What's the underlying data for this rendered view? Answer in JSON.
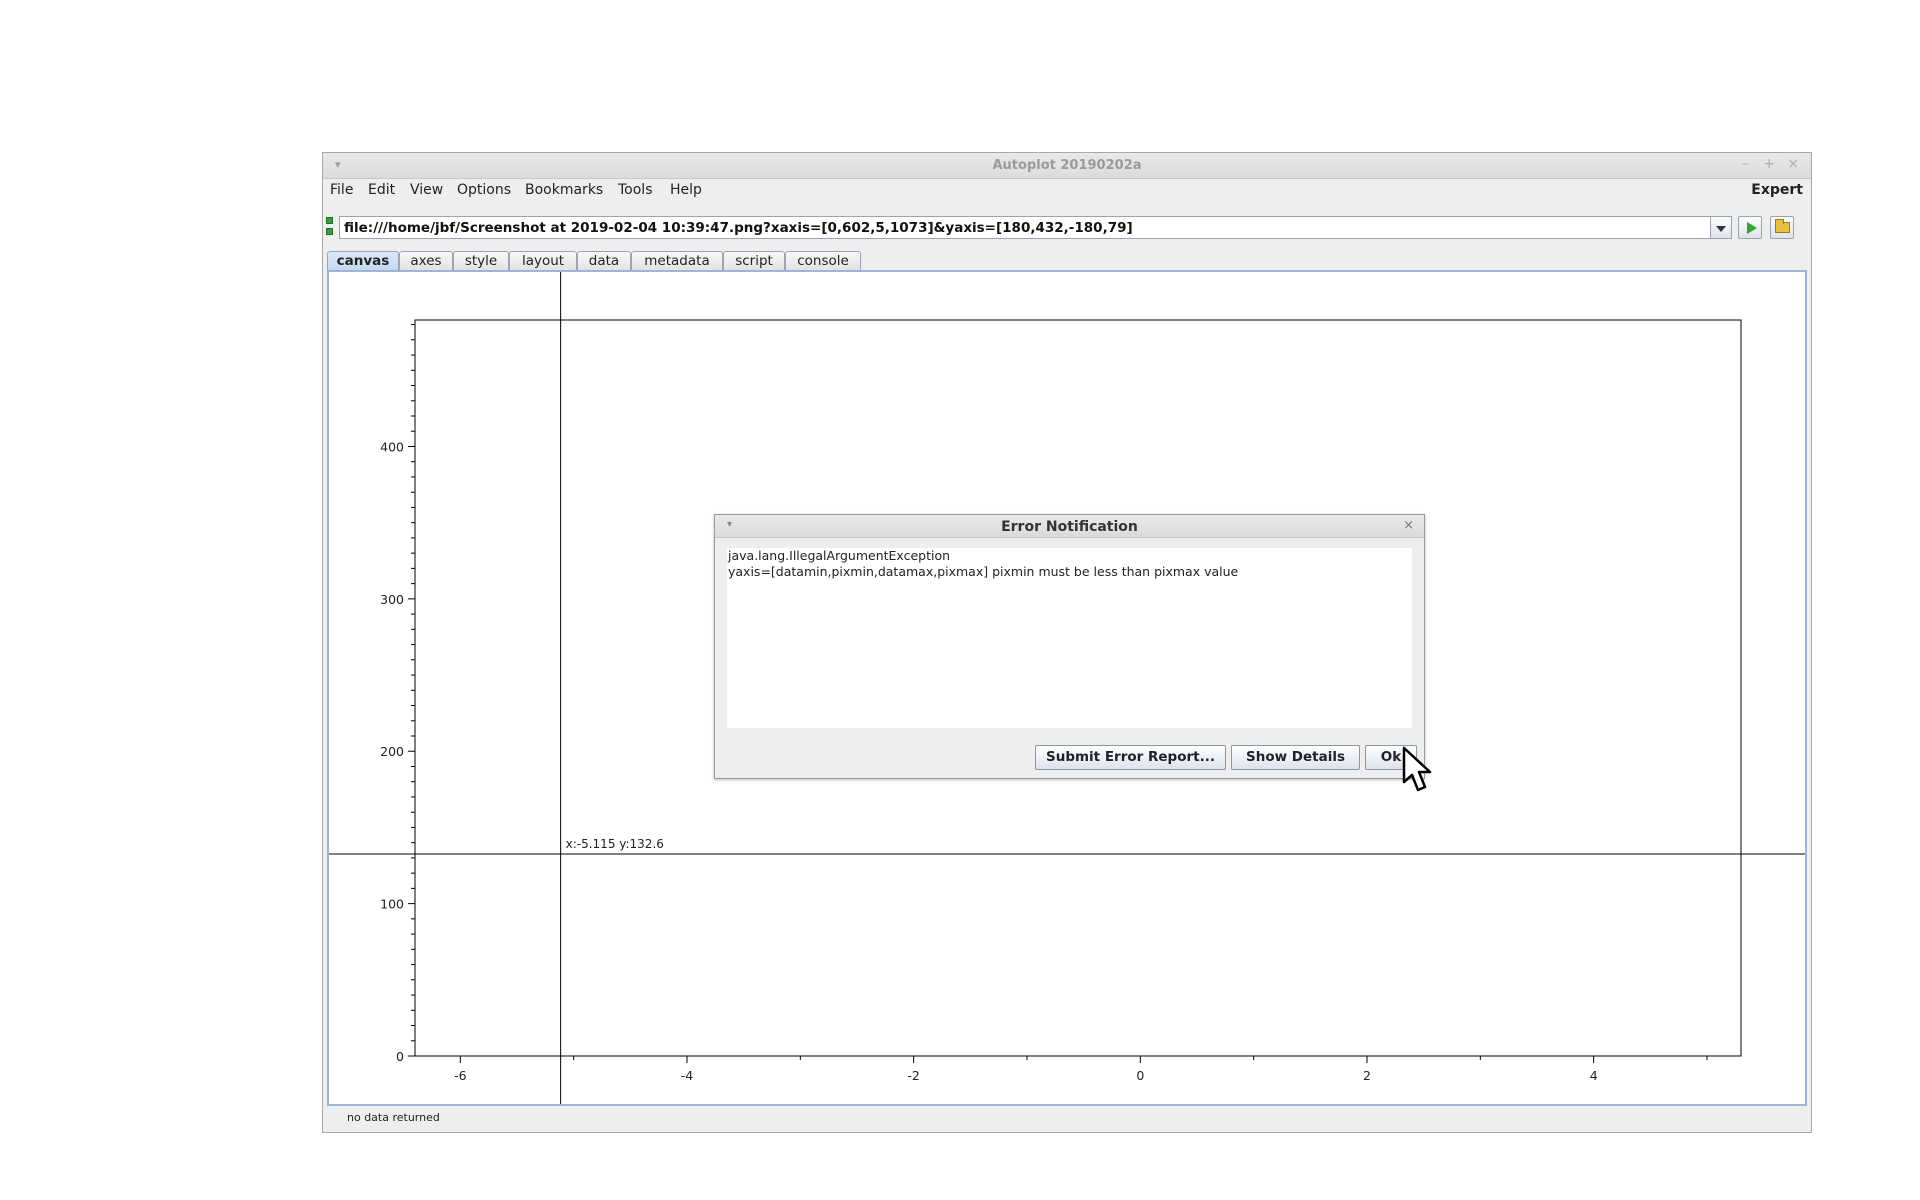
{
  "window": {
    "title": "Autoplot 20190202a",
    "menu_arrow": "▾",
    "controls": [
      "–",
      "+",
      "×"
    ]
  },
  "menubar": {
    "items": [
      "File",
      "Edit",
      "View",
      "Options",
      "Bookmarks",
      "Tools",
      "Help"
    ],
    "expert_label": "Expert"
  },
  "address": {
    "value": "file:///home/jbf/Screenshot at 2019-02-04 10:39:47.png?xaxis=[0,602,5,1073]&yaxis=[180,432,-180,79]"
  },
  "tabs": [
    {
      "label": "canvas",
      "active": true
    },
    {
      "label": "axes",
      "active": false
    },
    {
      "label": "style",
      "active": false
    },
    {
      "label": "layout",
      "active": false
    },
    {
      "label": "data",
      "active": false
    },
    {
      "label": "metadata",
      "active": false
    },
    {
      "label": "script",
      "active": false
    },
    {
      "label": "console",
      "active": false
    }
  ],
  "chart_data": {
    "type": "scatter",
    "x_ticks": [
      -6,
      -4,
      -2,
      0,
      2,
      4
    ],
    "y_ticks": [
      0,
      100,
      200,
      300,
      400
    ],
    "xlim": [
      -6.4,
      5.3
    ],
    "ylim": [
      0,
      483
    ],
    "crosshair": {
      "x": -5.115,
      "y": 132.6
    },
    "crosshair_readout": "x:-5.115  y:132.6",
    "points": []
  },
  "status": {
    "text": "no data returned"
  },
  "dialog": {
    "title": "Error Notification",
    "arrow": "▾",
    "close": "×",
    "lines": [
      "java.lang.IllegalArgumentException",
      "yaxis=[datamin,pixmin,datamax,pixmax] pixmin must be less than pixmax value"
    ],
    "buttons": {
      "submit": "Submit Error Report...",
      "details": "Show Details",
      "ok": "Ok"
    }
  },
  "colors": {
    "tab_active": "#c4d8ef",
    "panel_border": "#9bb6d6",
    "play_green": "#2ea82e"
  }
}
